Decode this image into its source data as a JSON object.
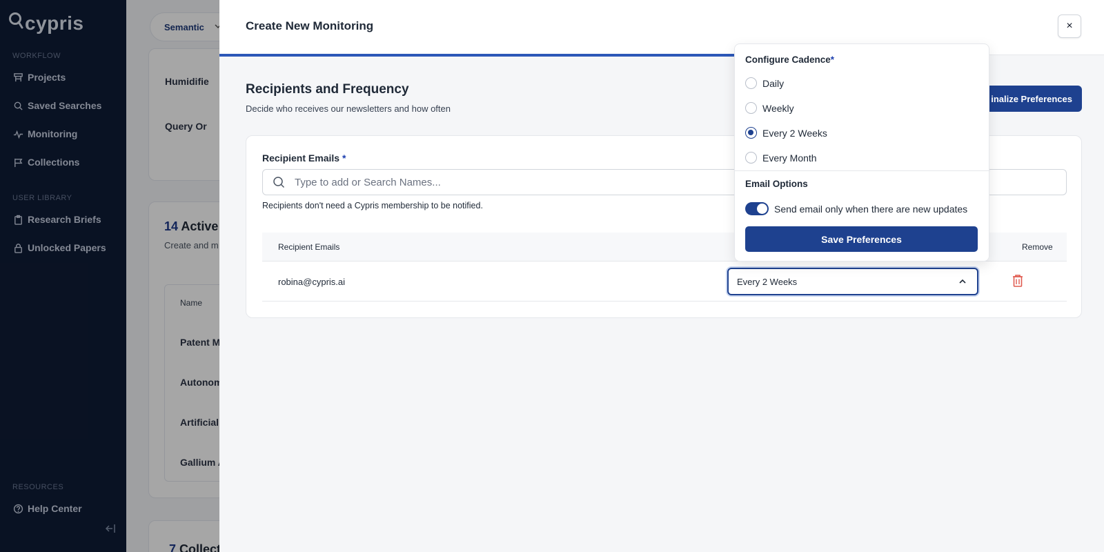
{
  "sidebar": {
    "logo": "cypris",
    "workflow_label": "WORKFLOW",
    "workflow_items": [
      {
        "label": "Projects",
        "icon": "projects-icon"
      },
      {
        "label": "Saved Searches",
        "icon": "search-icon"
      },
      {
        "label": "Monitoring",
        "icon": "activity-icon"
      },
      {
        "label": "Collections",
        "icon": "flag-icon"
      }
    ],
    "library_label": "USER LIBRARY",
    "library_items": [
      {
        "label": "Research Briefs",
        "icon": "clipboard-icon"
      },
      {
        "label": "Unlocked Papers",
        "icon": "lock-icon"
      }
    ],
    "resources_label": "RESOURCES",
    "resources_items": [
      {
        "label": "Help Center",
        "icon": "help-circle-icon"
      }
    ]
  },
  "background": {
    "search_mode": "Semantic",
    "rows_top": [
      "Humidifie",
      "Query Or"
    ],
    "active_count": "14",
    "active_title": "Active",
    "active_sub": "Create and m",
    "col_name": "Name",
    "rows": [
      "Patent M",
      "Autonom",
      "Artificial",
      "Gallium A"
    ],
    "collections_count": "7",
    "collections_title": "Collect"
  },
  "modal": {
    "title": "Create New Monitoring",
    "close_label": "×",
    "section_title": "Recipients and Frequency",
    "section_desc": "Decide who receives our newsletters and how often",
    "finalize_label": "inalize Preferences",
    "recipients_label": "Recipient Emails",
    "required_mark": "*",
    "search_placeholder": "Type to add or Search Names...",
    "helper": "Recipients don't need a Cypris membership to be notified.",
    "table": {
      "col_emails": "Recipient Emails",
      "col_remove": "Remove",
      "rows": [
        {
          "email": "robina@cypris.ai",
          "cadence": "Every 2 Weeks"
        }
      ]
    }
  },
  "popover": {
    "title": "Configure Cadence",
    "required_mark": "*",
    "options": [
      "Daily",
      "Weekly",
      "Every 2 Weeks",
      "Every Month"
    ],
    "selected": "Every 2 Weeks",
    "email_options_label": "Email Options",
    "toggle_label": "Send email only when there are new updates",
    "toggle_on": true,
    "save_label": "Save Preferences"
  },
  "colors": {
    "sidebar_bg": "#0f1c36",
    "accent": "#1e418f",
    "danger": "#e05a4f"
  }
}
